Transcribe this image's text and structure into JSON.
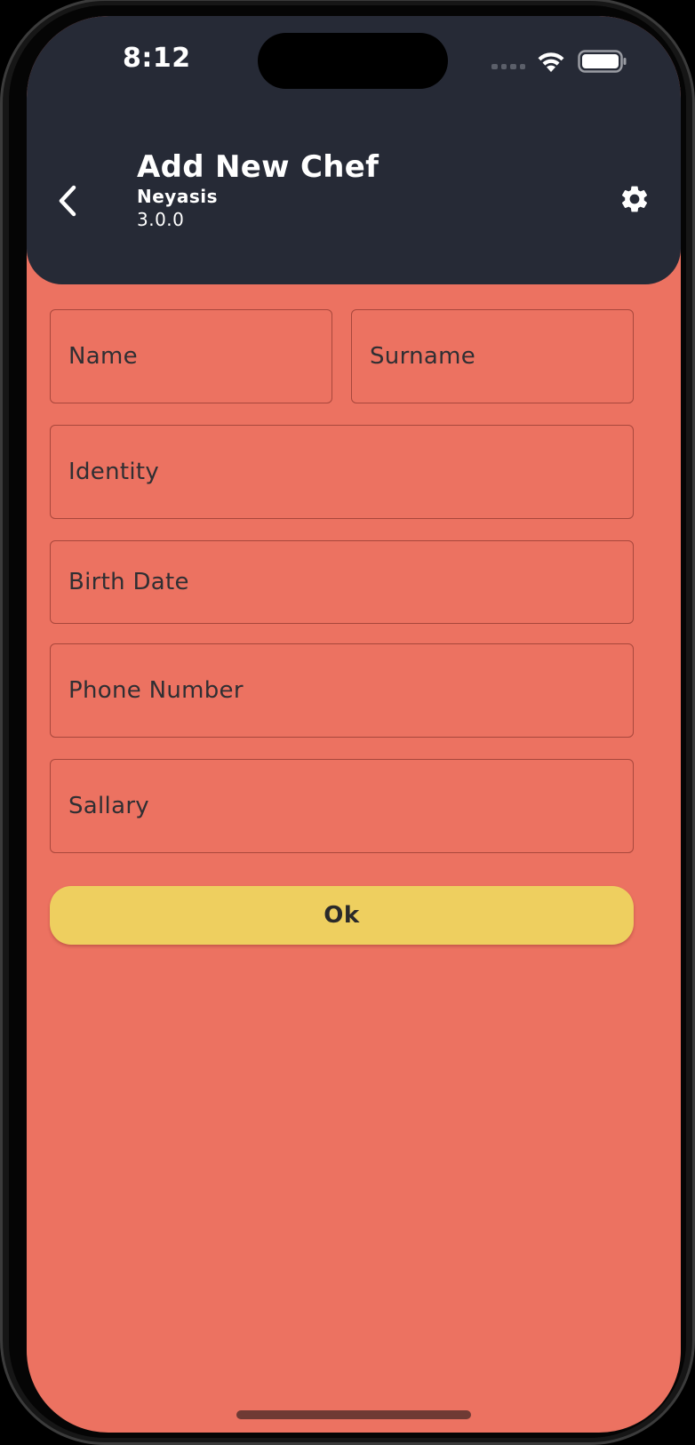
{
  "status_bar": {
    "time": "8:12"
  },
  "app_bar": {
    "title": "Add New Chef",
    "subtitle": "Neyasis",
    "version": "3.0.0",
    "back_icon": "chevron-left-icon",
    "settings_icon": "gear-icon"
  },
  "form": {
    "name": {
      "value": "",
      "placeholder": "Name"
    },
    "surname": {
      "value": "",
      "placeholder": "Surname"
    },
    "identity": {
      "value": "",
      "placeholder": "Identity"
    },
    "birth_date": {
      "value": "",
      "placeholder": "Birth Date"
    },
    "phone_number": {
      "value": "",
      "placeholder": "Phone Number"
    },
    "sallary": {
      "value": "",
      "placeholder": "Sallary"
    }
  },
  "actions": {
    "ok_label": "Ok"
  },
  "colors": {
    "app_bar_bg": "#262a36",
    "page_bg": "#ec7261",
    "field_border": "#a8473c",
    "button_bg": "#eecf5f",
    "text_dark": "#2b2b2f",
    "text_light": "#ffffff"
  }
}
